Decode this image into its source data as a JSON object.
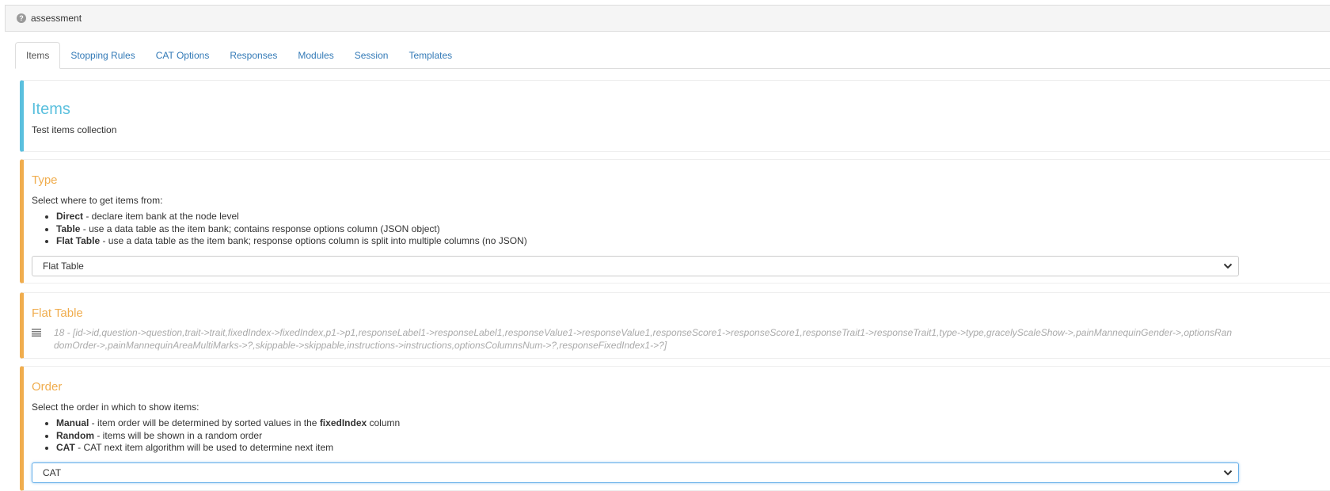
{
  "header": {
    "title": "assessment",
    "icon": "help-icon"
  },
  "tabs": [
    "Items",
    "Stopping Rules",
    "CAT Options",
    "Responses",
    "Modules",
    "Session",
    "Templates"
  ],
  "items_section": {
    "title": "Items",
    "description": "Test items collection"
  },
  "type_section": {
    "title": "Type",
    "description": "Select where to get items from:",
    "options": [
      {
        "name": "Direct",
        "text": " - declare item bank at the node level"
      },
      {
        "name": "Table",
        "text": " - use a data table as the item bank; contains response options column (JSON object)"
      },
      {
        "name": "Flat Table",
        "text": " - use a data table as the item bank; response options column is split into multiple columns (no JSON)"
      }
    ],
    "selected": "Flat Table"
  },
  "flat_table_section": {
    "title": "Flat Table",
    "icon": "list-icon",
    "value": "18 - [id->id,question->question,trait->trait,fixedIndex->fixedIndex,p1->p1,responseLabel1->responseLabel1,responseValue1->responseValue1,responseScore1->responseScore1,responseTrait1->responseTrait1,type->type,gracelyScaleShow->,painMannequinGender->,optionsRandomOrder->,painMannequinAreaMultiMarks->?,skippable->skippable,instructions->instructions,optionsColumnsNum->?,responseFixedIndex1->?]"
  },
  "order_section": {
    "title": "Order",
    "description": "Select the order in which to show items:",
    "options": [
      {
        "name": "Manual",
        "text_before": " - item order will be determined by sorted values in the ",
        "bold": "fixedIndex",
        "text_after": " column"
      },
      {
        "name": "Random",
        "text": " - items will be shown in a random order"
      },
      {
        "name": "CAT",
        "text": " - CAT next item algorithm will be used to determine next item"
      }
    ],
    "selected": "CAT"
  },
  "colors": {
    "info": "#5bc0de",
    "warning": "#f0ad4e",
    "link": "#337ab7",
    "focus": "#66afe9"
  }
}
